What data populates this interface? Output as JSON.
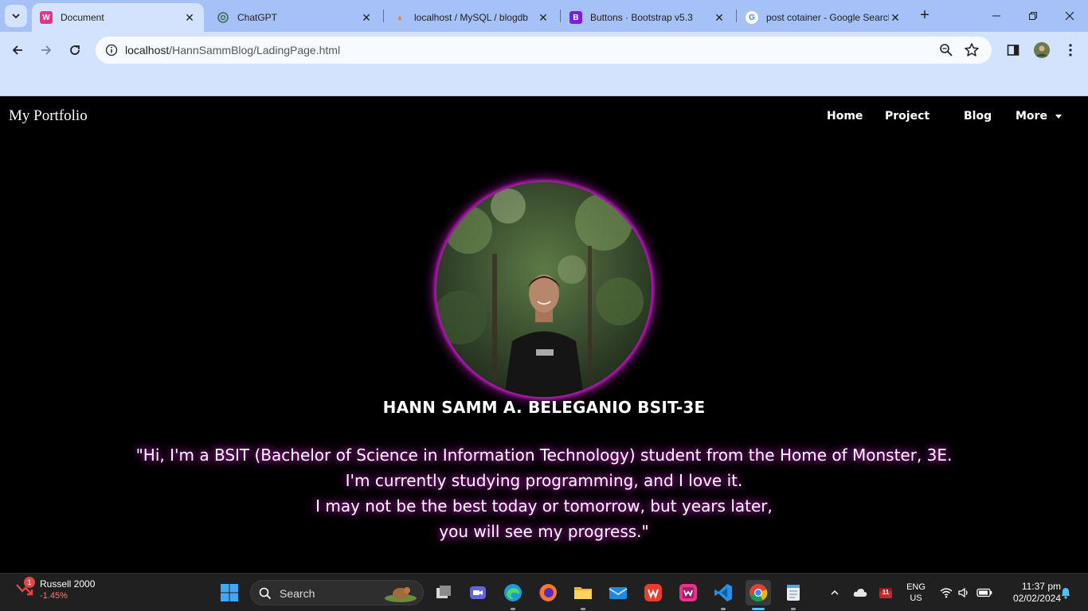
{
  "browser": {
    "tabs": [
      {
        "title": "Document",
        "active": true,
        "icon": "webstorm-icon"
      },
      {
        "title": "ChatGPT",
        "active": false,
        "icon": "chatgpt-icon"
      },
      {
        "title": "localhost / MySQL / blogdb",
        "active": false,
        "icon": "phpmyadmin-icon"
      },
      {
        "title": "Buttons · Bootstrap v5.3",
        "active": false,
        "icon": "bootstrap-icon"
      },
      {
        "title": "post cotainer - Google Search",
        "active": false,
        "icon": "google-icon"
      }
    ],
    "url_host": "localhost",
    "url_path": "/HannSammBlog/LadingPage.html"
  },
  "page": {
    "brand": "My Portfolio",
    "nav": {
      "home": "Home",
      "project": "Project",
      "blog": "Blog",
      "more": "More"
    },
    "name": "HANN SAMM A. BELEGANIO BSIT-3E",
    "quote_lines": [
      "\"Hi, I'm a BSIT (Bachelor of Science in Information Technology) student from the Home of Monster, 3E.",
      "I'm currently studying programming, and I love it.",
      "I may not be the best today or tomorrow, but years later,",
      "you will see my progress.\""
    ],
    "colors": {
      "glow": "#b01ab0",
      "background": "#000000"
    }
  },
  "taskbar": {
    "widget_title": "Russell 2000",
    "widget_value": "-1.45%",
    "widget_badge": "1",
    "search_label": "Search",
    "lang_line1": "ENG",
    "lang_line2": "US",
    "time": "11:37 pm",
    "date": "02/02/2024",
    "calendar_badge": "11"
  }
}
